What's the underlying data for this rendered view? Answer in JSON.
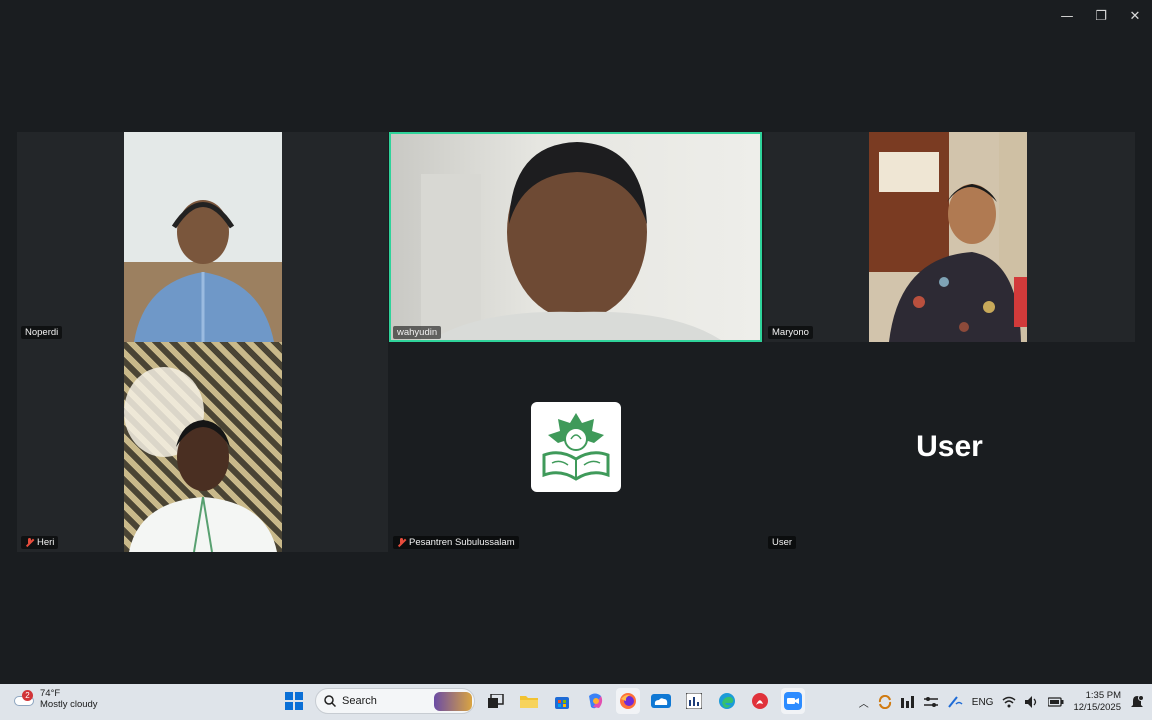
{
  "window": {
    "minimize": "—",
    "restore": "❐",
    "close": "✕"
  },
  "participants": [
    {
      "name": "Noperdi",
      "muted": false
    },
    {
      "name": "wahyudin",
      "muted": false,
      "speaking": true
    },
    {
      "name": "Maryono",
      "muted": false
    },
    {
      "name": "Heri",
      "muted": true
    },
    {
      "name": "Pesantren Subulussalam",
      "muted": true
    },
    {
      "name": "User",
      "muted": false,
      "avatar_text": "User"
    }
  ],
  "taskbar": {
    "weather": {
      "badge": "2",
      "temp": "74°F",
      "condition": "Mostly cloudy"
    },
    "search_label": "Search",
    "tray": {
      "lang": "ENG",
      "time": "1:35 PM",
      "date": "12/15/2025"
    }
  },
  "colors": {
    "speaking_border": "#2fd39a",
    "muted": "#e74c3c",
    "taskbar": "#dfe4ea"
  }
}
